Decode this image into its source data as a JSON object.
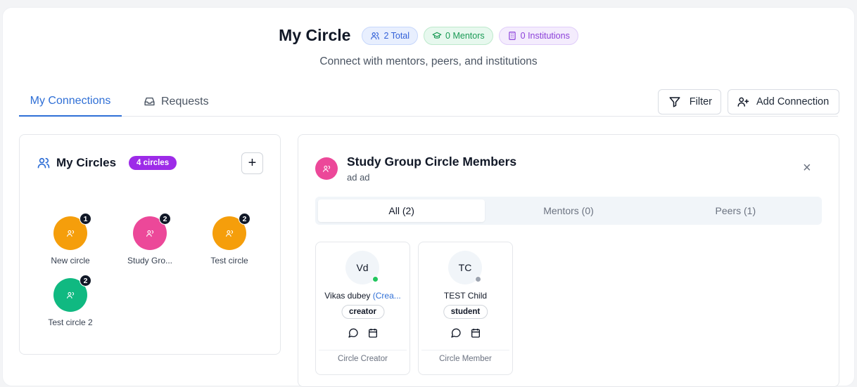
{
  "header": {
    "title": "My Circle",
    "badges": {
      "total": "2 Total",
      "mentors": "0 Mentors",
      "institutions": "0 Institutions"
    },
    "subtitle": "Connect with mentors, peers, and institutions"
  },
  "tabs": {
    "connections": "My Connections",
    "requests": "Requests"
  },
  "toolbar": {
    "filter": "Filter",
    "add_connection": "Add Connection"
  },
  "circles": {
    "title": "My Circles",
    "count_label": "4 circles",
    "add_symbol": "+",
    "items": [
      {
        "name": "New circle",
        "count": "1",
        "color": "#f59e0b"
      },
      {
        "name": "Study Gro...",
        "count": "2",
        "color": "#ec4899"
      },
      {
        "name": "Test circle",
        "count": "2",
        "color": "#f59e0b"
      },
      {
        "name": "Test circle 2",
        "count": "2",
        "color": "#10b981"
      }
    ]
  },
  "group": {
    "title": "Study Group Circle Members",
    "subtitle": "ad ad",
    "close_symbol": "×",
    "segments": {
      "all": "All (2)",
      "mentors": "Mentors (0)",
      "peers": "Peers (1)"
    },
    "members": [
      {
        "initials": "Vd",
        "name": "Vikas dubey",
        "name_suffix": "(Crea...",
        "role": "creator",
        "footer": "Circle Creator",
        "status_color": "#22c55e"
      },
      {
        "initials": "TC",
        "name": "TEST Child",
        "name_suffix": "",
        "role": "student",
        "footer": "Circle Member",
        "status_color": "#9ca3af"
      }
    ]
  },
  "colors": {
    "accent": "#2f6fd6",
    "purple": "#9d2be8",
    "pink": "#ec4899"
  }
}
